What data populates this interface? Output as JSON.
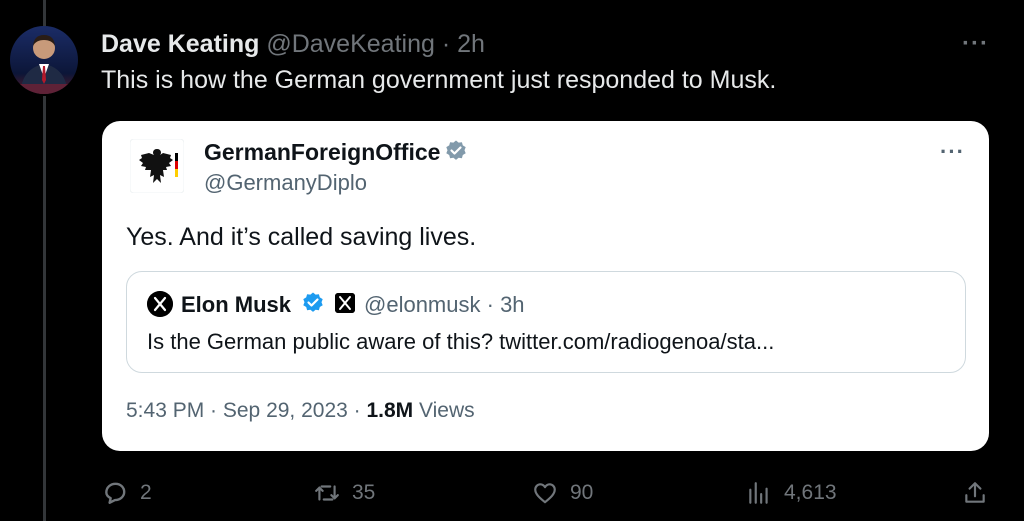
{
  "tweet": {
    "author_name": "Dave Keating",
    "author_handle": "@DaveKeating",
    "time": "· 2h",
    "text": "This is how the German government just responded to Musk.",
    "more_icon": "more-horizontal-icon"
  },
  "quoted": {
    "author_name": "GermanForeignOffice",
    "author_handle": "@GermanyDiplo",
    "text": "Yes. And it’s called saving lives.",
    "nested_quote": {
      "author_name": "Elon Musk",
      "author_handle": "@elonmusk",
      "time": "· 3h",
      "text": "Is the German public aware of this? twitter.com/radiogenoa/sta..."
    },
    "timestamp": "5:43 PM · Sep 29, 2023 · ",
    "views_count": "1.8M",
    "views_label": " Views"
  },
  "actions": {
    "replies": "2",
    "reposts": "35",
    "likes": "90",
    "views": "4,613"
  },
  "colors": {
    "background": "#000000",
    "card": "#ffffff",
    "verified": "#1d9bf0",
    "muted": "#71767b"
  }
}
